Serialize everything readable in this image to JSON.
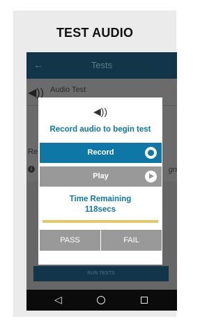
{
  "card": {
    "title": "TEST AUDIO"
  },
  "appbar": {
    "back_icon": "←",
    "title": "Tests"
  },
  "background": {
    "row1_label": "Audio Test",
    "row2_label": "Re",
    "row3_label": "gn"
  },
  "dialog": {
    "icon": "speaker-icon",
    "message": "Record audio to begin test",
    "record_label": "Record",
    "play_label": "Play",
    "time_label": "Time Remaining",
    "time_value": "118secs",
    "progress": 1.0,
    "pass_label": "PASS",
    "fail_label": "FAIL"
  },
  "run_button_label": "RUN TESTS",
  "navbar": {
    "back": "◁"
  },
  "colors": {
    "accent": "#0e77a6",
    "appbar": "#12354a",
    "button_gray": "#999999",
    "progress": "#e6c86a"
  }
}
